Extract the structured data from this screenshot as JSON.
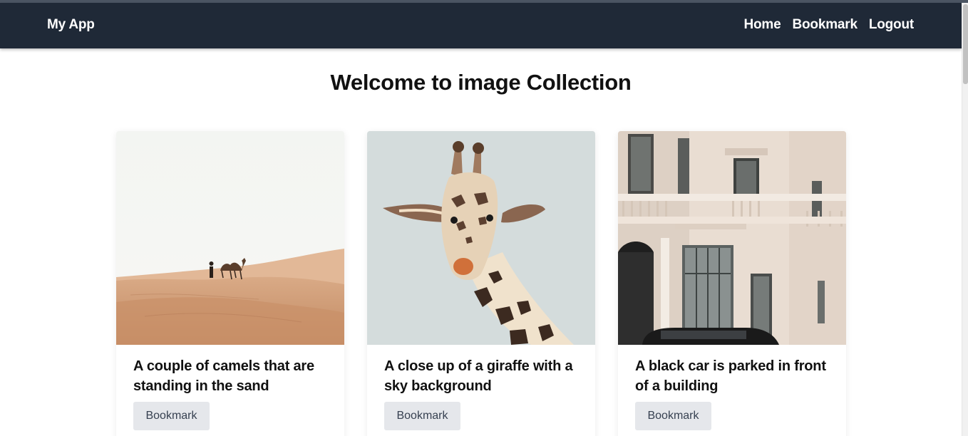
{
  "nav": {
    "brand": "My App",
    "links": [
      "Home",
      "Bookmark",
      "Logout"
    ]
  },
  "page": {
    "title": "Welcome to image Collection"
  },
  "cards": [
    {
      "image": "desert-camels-photo",
      "title": "A couple of camels that are standing in the sand",
      "button": "Bookmark"
    },
    {
      "image": "giraffe-portrait-photo",
      "title": "A close up of a giraffe with a sky background",
      "button": "Bookmark"
    },
    {
      "image": "building-facade-photo",
      "title": "A black car is parked in front of a building",
      "button": "Bookmark"
    }
  ],
  "colors": {
    "navbar": "#1f2937",
    "button_bg": "#e5e7eb",
    "button_text": "#374151"
  }
}
